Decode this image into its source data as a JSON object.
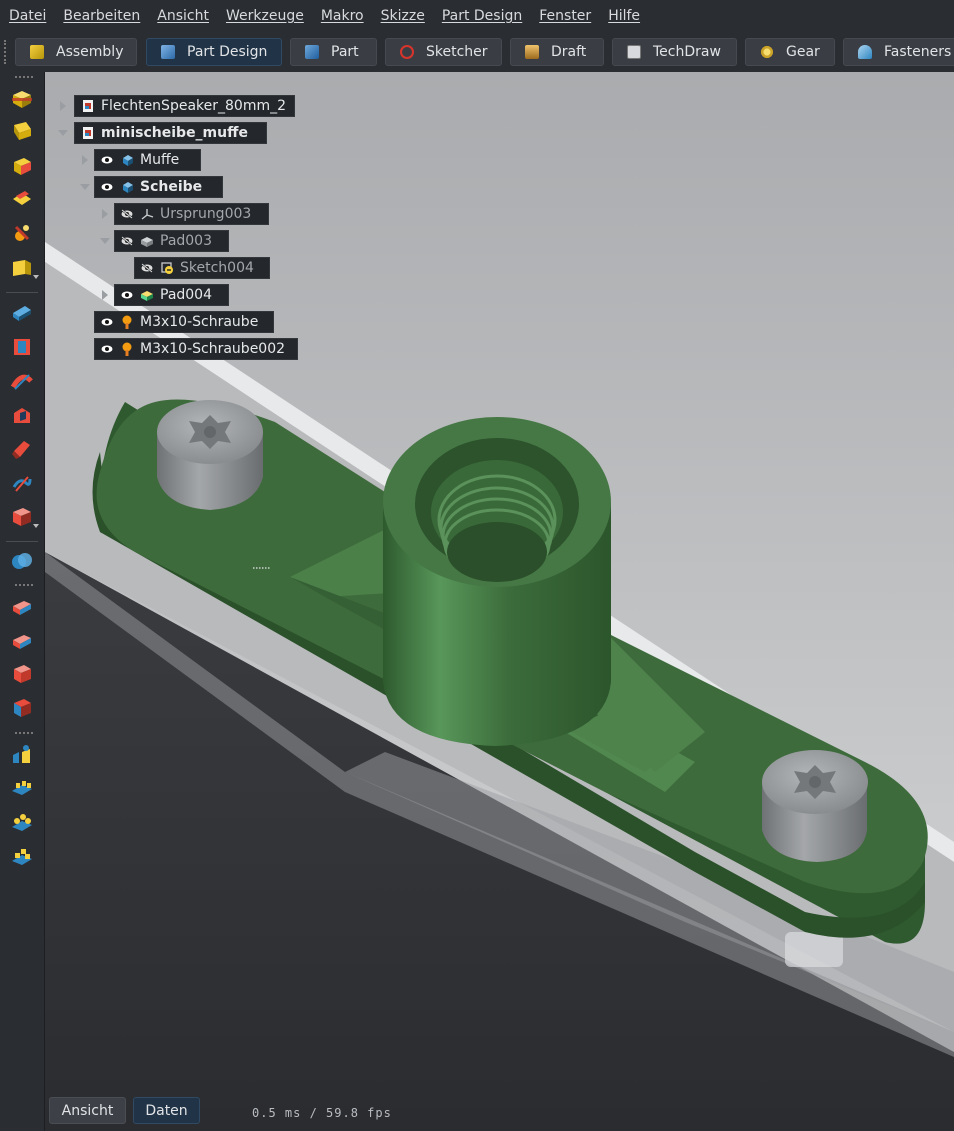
{
  "menu": [
    "Datei",
    "Bearbeiten",
    "Ansicht",
    "Werkzeuge",
    "Makro",
    "Skizze",
    "Part Design",
    "Fenster",
    "Hilfe"
  ],
  "workbenches": [
    {
      "label": "Assembly",
      "icon": "assembly-icon",
      "active": false
    },
    {
      "label": "Part Design",
      "icon": "part-design-icon",
      "active": true
    },
    {
      "label": "Part",
      "icon": "part-cube-icon",
      "active": false
    },
    {
      "label": "Sketcher",
      "icon": "sketcher-icon",
      "active": false
    },
    {
      "label": "Draft",
      "icon": "draft-icon",
      "active": false
    },
    {
      "label": "TechDraw",
      "icon": "techdraw-icon",
      "active": false
    },
    {
      "label": "Gear",
      "icon": "gear-icon",
      "active": false
    },
    {
      "label": "Fasteners",
      "icon": "fasteners-icon",
      "active": false
    }
  ],
  "tree": [
    {
      "label": "FlechtenSpeaker_80mm_2",
      "icon": "document-icon",
      "bold": false,
      "dim": false,
      "visible": null
    },
    {
      "label": "minischeibe_muffe",
      "icon": "document-icon",
      "bold": true,
      "dim": false,
      "visible": null
    },
    {
      "label": "Muffe",
      "icon": "body-icon",
      "bold": false,
      "dim": false,
      "visible": true
    },
    {
      "label": "Scheibe",
      "icon": "body-icon",
      "bold": true,
      "dim": false,
      "visible": true
    },
    {
      "label": "Ursprung003",
      "icon": "origin-icon",
      "bold": false,
      "dim": true,
      "visible": false
    },
    {
      "label": "Pad003",
      "icon": "pad-icon",
      "bold": false,
      "dim": true,
      "visible": false
    },
    {
      "label": "Sketch004",
      "icon": "sketch-icon",
      "bold": false,
      "dim": true,
      "visible": false
    },
    {
      "label": "Pad004",
      "icon": "pad-icon",
      "bold": false,
      "dim": false,
      "visible": true
    },
    {
      "label": "M3x10-Schraube",
      "icon": "screw-icon",
      "bold": false,
      "dim": false,
      "visible": true
    },
    {
      "label": "M3x10-Schraube002",
      "icon": "screw-icon",
      "bold": false,
      "dim": false,
      "visible": true
    }
  ],
  "bottom_tabs": {
    "ansicht": "Ansicht",
    "daten": "Daten"
  },
  "status": {
    "fps": "0.5 ms / 59.8 fps"
  },
  "colors": {
    "part_green": "#3e6b3c",
    "screw_gray": "#8a8d90",
    "bg_top": "#c6c7c9",
    "bg_bottom": "#2a2c30",
    "accent_blue": "#213447"
  }
}
